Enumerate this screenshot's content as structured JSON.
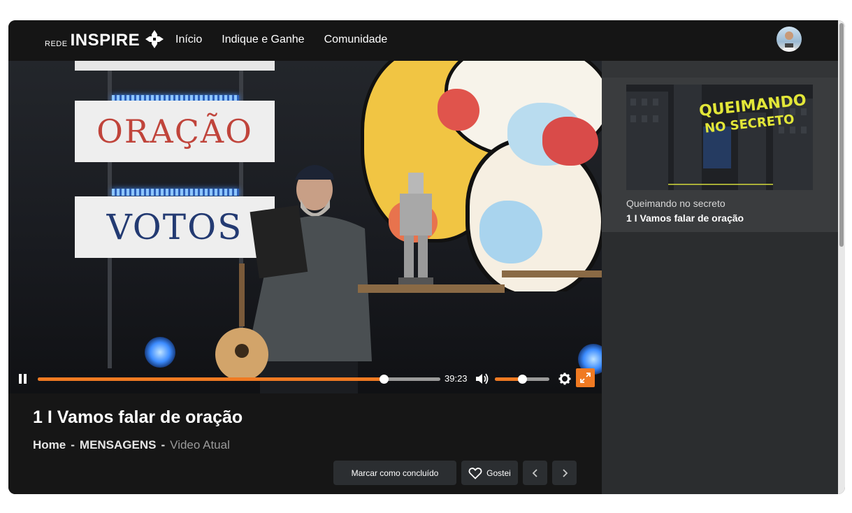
{
  "header": {
    "logo_prefix": "REDE",
    "logo_name": "INSPIRE",
    "nav": [
      "Início",
      "Indique e Ganhe",
      "Comunidade"
    ]
  },
  "video": {
    "sign_top_text": "ORAÇÃO",
    "sign_bottom_text": "VOTOS",
    "time_remaining": "39:23",
    "progress": 0.86,
    "volume": 0.5
  },
  "info": {
    "title": "1 I Vamos falar de oração",
    "breadcrumb": {
      "home": "Home",
      "sep": "-",
      "section": "MENSAGENS",
      "current": "Video Atual"
    },
    "mark_done_label": "Marcar como concluído",
    "like_label": "Gostei"
  },
  "sidebar": {
    "card": {
      "thumb_text_1": "QUEIMANDO",
      "thumb_text_2": "NO SECRETO",
      "series": "Queimando no secreto",
      "title": "1 I Vamos falar de oração"
    }
  },
  "colors": {
    "accent": "#f07a22",
    "background": "#161616",
    "sidebar": "#2b2d2f",
    "card": "#3a3c3e"
  }
}
